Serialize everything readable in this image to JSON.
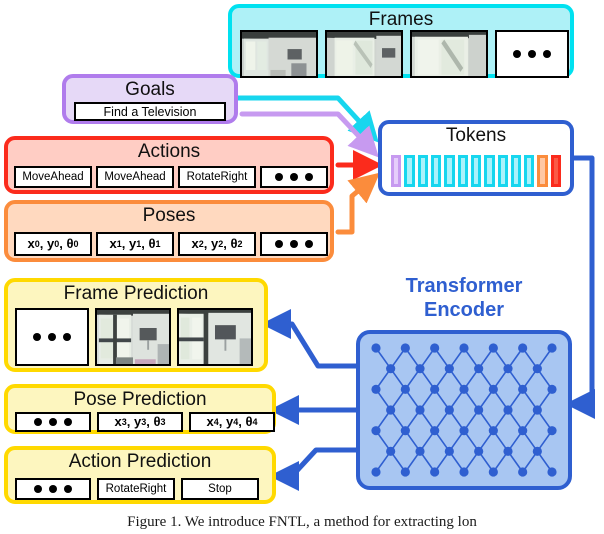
{
  "figure": {
    "caption": "Figure 1.  We introduce FNTL, a method for extracting lon"
  },
  "frames": {
    "title": "Frames",
    "items": [
      {
        "kind": "image",
        "name": "frame-thumbnail-0"
      },
      {
        "kind": "image",
        "name": "frame-thumbnail-1"
      },
      {
        "kind": "image",
        "name": "frame-thumbnail-2"
      },
      {
        "kind": "ellipsis",
        "name": "frame-ellipsis"
      }
    ],
    "border_color": "#00e1f0",
    "fill_color": "#aef1f7"
  },
  "goals": {
    "title": "Goals",
    "value": "Find a Television",
    "border_color": "#b07cec",
    "fill_color": "#e6d9f7"
  },
  "actions": {
    "title": "Actions",
    "items": [
      "MoveAhead",
      "MoveAhead",
      "RotateRight"
    ],
    "ellipsis": "• • •",
    "border_color": "#fb2b1c",
    "fill_color": "#ffcdc4"
  },
  "poses": {
    "title": "Poses",
    "items": [
      {
        "x": "x",
        "y": "y",
        "t": "θ",
        "idx": "0"
      },
      {
        "x": "x",
        "y": "y",
        "t": "θ",
        "idx": "1"
      },
      {
        "x": "x",
        "y": "y",
        "t": "θ",
        "idx": "2"
      }
    ],
    "ellipsis": "• • •",
    "border_color": "#fb8c3c",
    "fill_color": "#ffd9bf"
  },
  "tokens": {
    "title": "Tokens",
    "border_color": "#2f5fd0",
    "sequence": [
      "purple",
      "cyan",
      "cyan",
      "cyan",
      "cyan",
      "cyan",
      "cyan",
      "cyan",
      "cyan",
      "cyan",
      "cyan",
      "ltorange",
      "red"
    ]
  },
  "encoder": {
    "label_line1": "Transformer",
    "label_line2": "Encoder",
    "label_color": "#2f5fd0",
    "fill_color": "#a8c6f2",
    "node_color": "#2f5fd0",
    "rows": 7,
    "cols": 7
  },
  "frame_prediction": {
    "title": "Frame Prediction",
    "items": [
      {
        "kind": "ellipsis",
        "name": "framepred-ellipsis"
      },
      {
        "kind": "image",
        "name": "framepred-thumbnail-3"
      },
      {
        "kind": "image",
        "name": "framepred-thumbnail-4"
      }
    ],
    "border_color": "#ffd900",
    "fill_color": "#fdf6bf"
  },
  "pose_prediction": {
    "title": "Pose Prediction",
    "ellipsis": "• • •",
    "items": [
      {
        "x": "x",
        "y": "y",
        "t": "θ",
        "idx": "3"
      },
      {
        "x": "x",
        "y": "y",
        "t": "θ",
        "idx": "4"
      }
    ]
  },
  "action_prediction": {
    "title": "Action Prediction",
    "ellipsis": "• • •",
    "items": [
      "RotateRight",
      "Stop"
    ]
  },
  "arrows": {
    "frames_to_tokens_color": "#17d6ee",
    "goals_to_tokens_color": "#c79af0",
    "actions_to_tokens_color": "#fb2b1c",
    "poses_to_tokens_color": "#fb8c3c",
    "tokens_to_encoder_color": "#2f5fd0",
    "encoder_to_predictions_color": "#2f5fd0"
  }
}
